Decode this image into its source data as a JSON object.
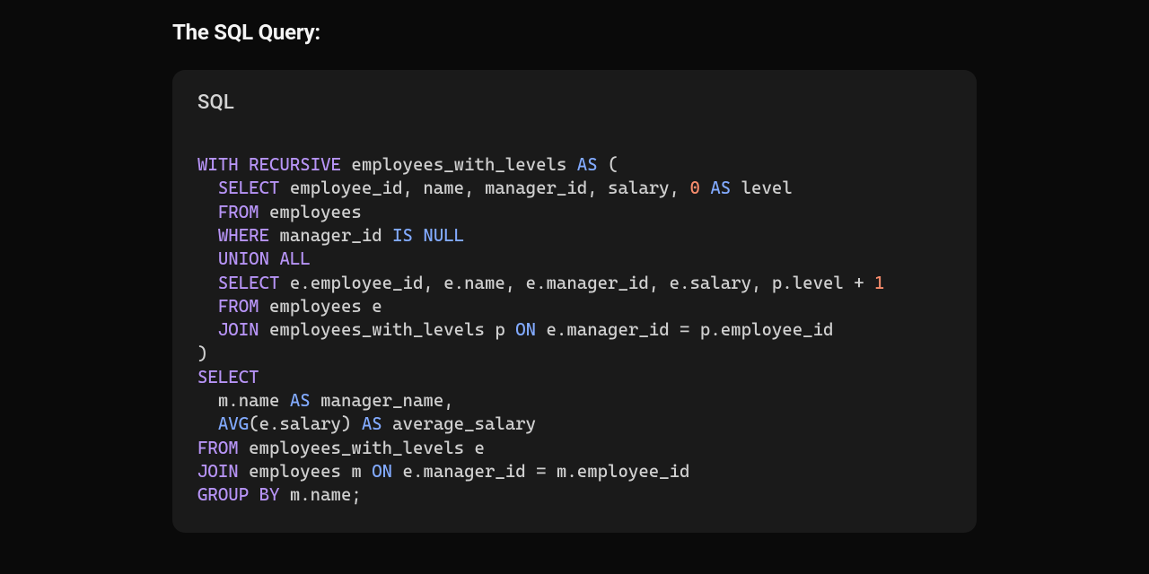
{
  "heading": "The SQL Query:",
  "code_lang": "SQL",
  "code": {
    "tokens": [
      {
        "t": "WITH",
        "c": "kw"
      },
      {
        "t": " ",
        "c": "id"
      },
      {
        "t": "RECURSIVE",
        "c": "kw"
      },
      {
        "t": " employees_with_levels ",
        "c": "id"
      },
      {
        "t": "AS",
        "c": "kw2"
      },
      {
        "t": " (",
        "c": "punct"
      },
      {
        "t": "\n",
        "c": "id"
      },
      {
        "t": "  ",
        "c": "id"
      },
      {
        "t": "SELECT",
        "c": "kw"
      },
      {
        "t": " employee_id, name, manager_id, salary, ",
        "c": "id"
      },
      {
        "t": "0",
        "c": "num"
      },
      {
        "t": " ",
        "c": "id"
      },
      {
        "t": "AS",
        "c": "kw2"
      },
      {
        "t": " level",
        "c": "id"
      },
      {
        "t": "\n",
        "c": "id"
      },
      {
        "t": "  ",
        "c": "id"
      },
      {
        "t": "FROM",
        "c": "kw"
      },
      {
        "t": " employees",
        "c": "id"
      },
      {
        "t": "\n",
        "c": "id"
      },
      {
        "t": "  ",
        "c": "id"
      },
      {
        "t": "WHERE",
        "c": "kw"
      },
      {
        "t": " manager_id ",
        "c": "id"
      },
      {
        "t": "IS",
        "c": "kw2"
      },
      {
        "t": " ",
        "c": "id"
      },
      {
        "t": "NULL",
        "c": "kw2"
      },
      {
        "t": "\n",
        "c": "id"
      },
      {
        "t": "  ",
        "c": "id"
      },
      {
        "t": "UNION",
        "c": "kw"
      },
      {
        "t": " ",
        "c": "id"
      },
      {
        "t": "ALL",
        "c": "kw"
      },
      {
        "t": "\n",
        "c": "id"
      },
      {
        "t": "  ",
        "c": "id"
      },
      {
        "t": "SELECT",
        "c": "kw"
      },
      {
        "t": " e.employee_id, e.name, e.manager_id, e.salary, p.level + ",
        "c": "id"
      },
      {
        "t": "1",
        "c": "num"
      },
      {
        "t": "\n",
        "c": "id"
      },
      {
        "t": "  ",
        "c": "id"
      },
      {
        "t": "FROM",
        "c": "kw"
      },
      {
        "t": " employees e",
        "c": "id"
      },
      {
        "t": "\n",
        "c": "id"
      },
      {
        "t": "  ",
        "c": "id"
      },
      {
        "t": "JOIN",
        "c": "kw"
      },
      {
        "t": " employees_with_levels p ",
        "c": "id"
      },
      {
        "t": "ON",
        "c": "kw2"
      },
      {
        "t": " e.manager_id = p.employee_id",
        "c": "id"
      },
      {
        "t": "\n",
        "c": "id"
      },
      {
        "t": ")",
        "c": "punct"
      },
      {
        "t": "\n",
        "c": "id"
      },
      {
        "t": "SELECT",
        "c": "kw"
      },
      {
        "t": "\n",
        "c": "id"
      },
      {
        "t": "  m.name ",
        "c": "id"
      },
      {
        "t": "AS",
        "c": "kw2"
      },
      {
        "t": " manager_name,",
        "c": "id"
      },
      {
        "t": "\n",
        "c": "id"
      },
      {
        "t": "  ",
        "c": "id"
      },
      {
        "t": "AVG",
        "c": "kw2"
      },
      {
        "t": "(e.salary) ",
        "c": "id"
      },
      {
        "t": "AS",
        "c": "kw2"
      },
      {
        "t": " average_salary",
        "c": "id"
      },
      {
        "t": "\n",
        "c": "id"
      },
      {
        "t": "FROM",
        "c": "kw"
      },
      {
        "t": " employees_with_levels e",
        "c": "id"
      },
      {
        "t": "\n",
        "c": "id"
      },
      {
        "t": "JOIN",
        "c": "kw"
      },
      {
        "t": " employees m ",
        "c": "id"
      },
      {
        "t": "ON",
        "c": "kw2"
      },
      {
        "t": " e.manager_id = m.employee_id",
        "c": "id"
      },
      {
        "t": "\n",
        "c": "id"
      },
      {
        "t": "GROUP BY",
        "c": "kw"
      },
      {
        "t": " m.name;",
        "c": "id"
      }
    ]
  }
}
